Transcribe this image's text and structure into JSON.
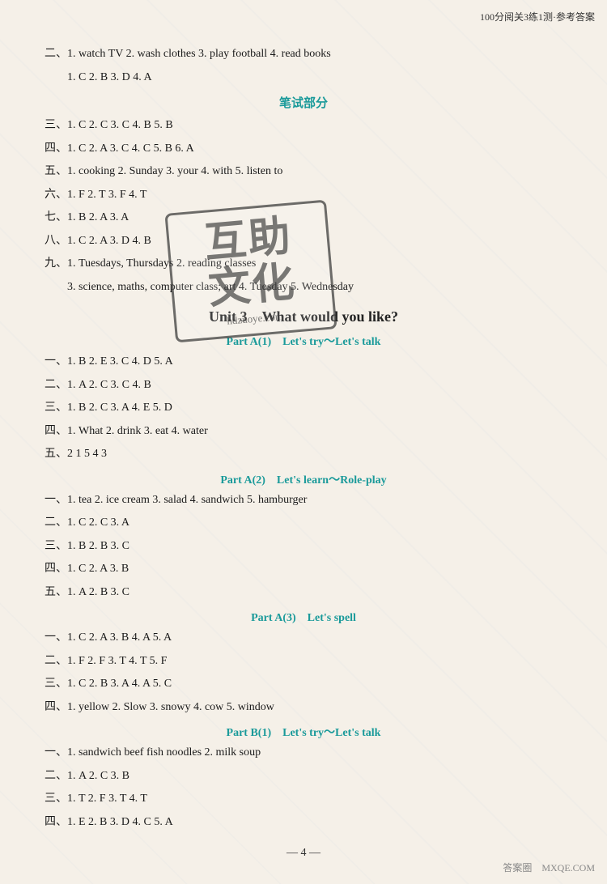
{
  "topRight": "100分阅关3练1测·参考答案",
  "sections": [
    {
      "id": "er-section",
      "lines": [
        "二、1. watch TV   2. wash clothes   3. play football   4. read books",
        "　　1. C   2. B   3. D   4. A"
      ]
    }
  ],
  "bishi": "笔试部分",
  "bishiLines": [
    "三、1. C   2. C   3. C   4. B   5. B",
    "四、1. C   2. A   3. C   4. C   5. B   6. A",
    "五、1. cooking   2. Sunday   3. your   4. with   5. listen to",
    "六、1. F   2. T   3. F   4. T",
    "七、1. B   2. A   3. A",
    "八、1. C   2. A   3. D   4. B",
    "九、1. Tuesdays, Thursdays   2. reading classes",
    "　　3. science, maths, computer class; art   4. Tuesday   5. Wednesday"
  ],
  "unitTitle": "Unit 3　What would you like?",
  "partA1Title": "Part A(1)　Let's try～Let's talk",
  "partA1Lines": [
    "一、1. B   2. E   3. C   4. D   5. A",
    "二、1. A   2. C   3. C   4. B",
    "三、1. B   2. C   3. A   4. E   5. D",
    "四、1. What   2. drink   3. eat   4. water",
    "五、2   1   5   4   3"
  ],
  "partA2Title": "Part A(2)　Let's learn～Role-play",
  "partA2Lines": [
    "一、1. tea   2. ice cream   3. salad   4. sandwich   5. hamburger",
    "二、1. C   2. C   3. A",
    "三、1. B   2. B   3. C",
    "四、1. C   2. A   3. B",
    "五、1. A   2. B   3. C"
  ],
  "partA3Title": "Part A(3)　Let's spell",
  "partA3Lines": [
    "一、1. C   2. A   3. B   4. A   5. A",
    "二、1. F   2. F   3. T   4. T   5. F",
    "三、1. C   2. B   3. A   4. A   5. C",
    "四、1. yellow   2. Slow   3. snowy   4. cow   5. window"
  ],
  "partB1Title": "Part B(1)　Let's try～Let's talk",
  "partB1Lines": [
    "一、1. sandwich   beef   fish   noodles   2. milk   soup",
    "二、1. A   2. C   3. B",
    "三、1. T   2. F   3. T   4. T",
    "四、1. E   2. B   3. D   4. C   5. A"
  ],
  "pageNum": "— 4 —",
  "bottomRight": "答案圈　MXQE.COM",
  "stamp": {
    "line1": "互助",
    "line2": "文化",
    "line3": "hdzuoye.com"
  }
}
